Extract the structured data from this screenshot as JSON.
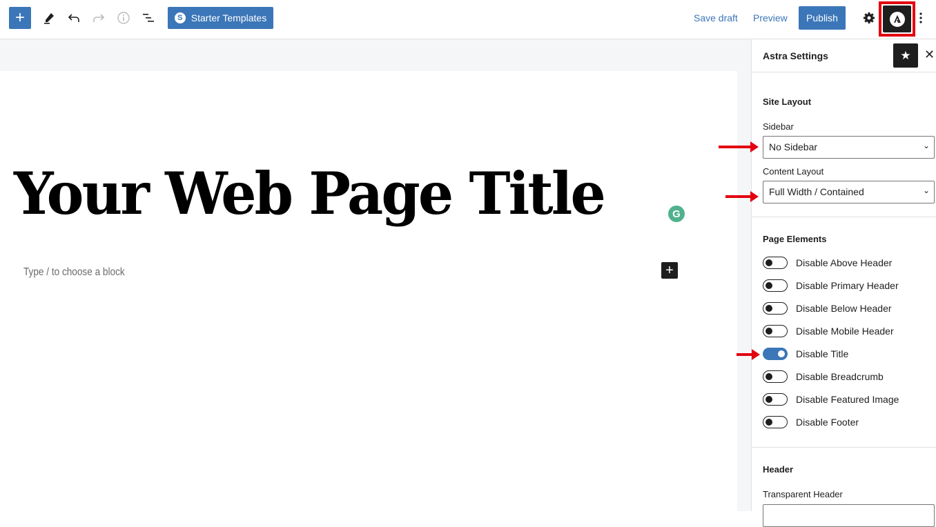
{
  "toolbar": {
    "add_block_icon": "plus-icon",
    "tools_icon": "pencil-icon",
    "undo_icon": "undo-icon",
    "redo_icon": "redo-icon",
    "info_icon": "info-icon",
    "list_view_icon": "list-view-icon",
    "starter_templates_label": "Starter Templates",
    "save_draft_label": "Save draft",
    "preview_label": "Preview",
    "publish_label": "Publish",
    "settings_icon": "gear-icon",
    "astra_icon": "astra-logo-icon",
    "more_icon": "more-vertical-icon"
  },
  "editor": {
    "page_title": "Your Web Page Title",
    "block_placeholder": "Type / to choose a block",
    "grammarly_letter": "G"
  },
  "sidebar": {
    "title": "Astra Settings",
    "site_layout": {
      "title": "Site Layout",
      "sidebar_label": "Sidebar",
      "sidebar_value": "No Sidebar",
      "content_layout_label": "Content Layout",
      "content_layout_value": "Full Width / Contained"
    },
    "page_elements": {
      "title": "Page Elements",
      "toggles": [
        {
          "label": "Disable Above Header",
          "on": false
        },
        {
          "label": "Disable Primary Header",
          "on": false
        },
        {
          "label": "Disable Below Header",
          "on": false
        },
        {
          "label": "Disable Mobile Header",
          "on": false
        },
        {
          "label": "Disable Title",
          "on": true
        },
        {
          "label": "Disable Breadcrumb",
          "on": false
        },
        {
          "label": "Disable Featured Image",
          "on": false
        },
        {
          "label": "Disable Footer",
          "on": false
        }
      ]
    },
    "header": {
      "title": "Header",
      "transparent_header_label": "Transparent Header"
    }
  },
  "colors": {
    "accent": "#3b76b8",
    "annotation_red": "#e3000f",
    "grammarly": "#4fb28d"
  }
}
